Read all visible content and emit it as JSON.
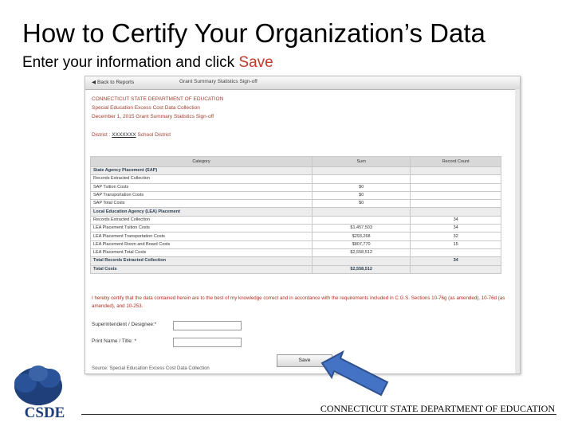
{
  "slide": {
    "title": "How to Certify Your Organization’s Data",
    "subtitle_prefix": "Enter your information and click ",
    "subtitle_highlight": "Save"
  },
  "app": {
    "back_label": "Back to Reports",
    "page_title": "Grant Summary Statistics Sign-off",
    "header_lines": [
      "CONNECTICUT STATE DEPARTMENT OF EDUCATION",
      "Special Education Excess Cost Data Collection",
      "December 1, 2015 Grant Summary Statistics Sign-off"
    ],
    "district_label": "District :",
    "district_value": "XXXXXXX",
    "district_suffix": "School District"
  },
  "table": {
    "headers": [
      "Category",
      "Sum",
      "Record Count"
    ],
    "rows": [
      {
        "type": "section",
        "cells": [
          "State Agency Placement (SAP)",
          "",
          ""
        ]
      },
      {
        "type": "row",
        "cells": [
          "Records Extracted Collection",
          "",
          ""
        ]
      },
      {
        "type": "row",
        "cells": [
          "SAP Tuition Costs",
          "$0",
          ""
        ]
      },
      {
        "type": "row",
        "cells": [
          "SAP Transportation Costs",
          "$0",
          ""
        ]
      },
      {
        "type": "row",
        "cells": [
          "SAP Total Costs",
          "$0",
          ""
        ]
      },
      {
        "type": "section",
        "cells": [
          "Local Education Agency (LEA) Placement",
          "",
          ""
        ]
      },
      {
        "type": "row",
        "cells": [
          "Records Extracted Collection",
          "",
          "34"
        ]
      },
      {
        "type": "row",
        "cells": [
          "LEA Placement Tuition Costs",
          "$1,457,503",
          "34"
        ]
      },
      {
        "type": "row",
        "cells": [
          "LEA Placement Transportation Costs",
          "$293,268",
          "32"
        ]
      },
      {
        "type": "row",
        "cells": [
          "LEA Placement Room and Board Costs",
          "$807,770",
          "15"
        ]
      },
      {
        "type": "row",
        "cells": [
          "LEA Placement Total Costs",
          "$2,558,512",
          ""
        ]
      },
      {
        "type": "section",
        "cells": [
          "Total Records Extracted Collection",
          "",
          "34"
        ]
      },
      {
        "type": "section",
        "cells": [
          "Total Costs",
          "$2,558,512",
          ""
        ]
      }
    ]
  },
  "form": {
    "certify_text": "I hereby certify that the data contained herein are to the best of my knowledge correct and in accordance with the requirements included in C.G.S. Sections 10-76g (as amended), 10-76d (as amended), and 10-253.",
    "superintendent_label": "Superintendent / Designee:*",
    "superintendent_value": "",
    "print_name_label": "Print Name / Title: *",
    "print_name_value": "",
    "save_label": "Save",
    "source_text": "Source: Special Education Excess Cost Data Collection"
  },
  "footer": {
    "logo_text": "CSDE",
    "org_name": "CONNECTICUT STATE DEPARTMENT OF EDUCATION"
  },
  "colors": {
    "highlight_red": "#c0392b",
    "arrow_blue": "#4472c4",
    "logo_blue": "#1f3f7a"
  },
  "icons": {
    "back": "arrow-left-icon",
    "pointer": "arrow-pointer-icon",
    "logo": "tree-logo"
  }
}
